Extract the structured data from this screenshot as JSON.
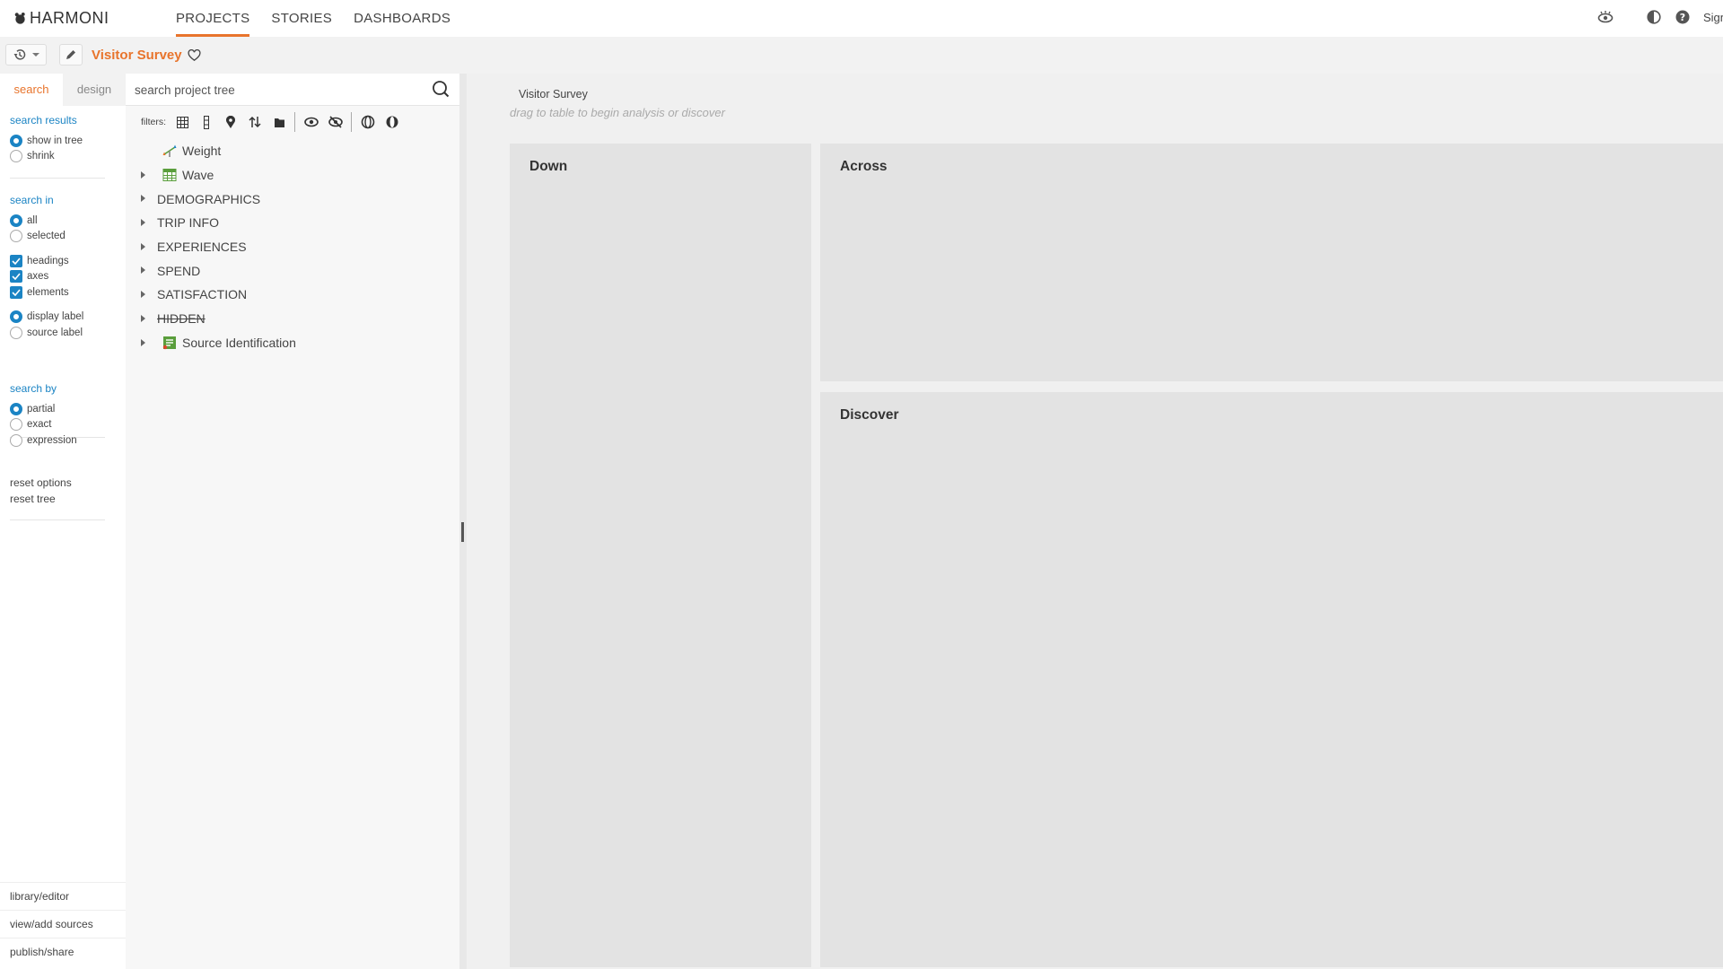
{
  "app": {
    "logo_text": "HARMONI",
    "nav": [
      {
        "label": "PROJECTS",
        "active": true
      },
      {
        "label": "STORIES",
        "active": false
      },
      {
        "label": "DASHBOARDS",
        "active": false
      }
    ],
    "sign_text": "Sign",
    "accent_color": "#e8742c",
    "link_color": "#1b84c4",
    "icons": [
      "view-icon",
      "contrast-icon",
      "help-icon"
    ]
  },
  "toolbar": {
    "history_icon": "history-icon",
    "edit_icon": "pencil-icon",
    "project_name": "Visitor Survey",
    "favorite_icon": "heart-icon"
  },
  "left_panel": {
    "tabs": [
      {
        "label": "search",
        "active": true
      },
      {
        "label": "design",
        "active": false
      }
    ],
    "search_results": {
      "heading": "search results",
      "options": [
        {
          "label": "show in tree",
          "selected": true
        },
        {
          "label": "shrink",
          "selected": false
        }
      ]
    },
    "search_in": {
      "heading": "search in",
      "scope": [
        {
          "label": "all",
          "selected": true
        },
        {
          "label": "selected",
          "selected": false
        }
      ],
      "types": [
        {
          "label": "headings",
          "checked": true
        },
        {
          "label": "axes",
          "checked": true
        },
        {
          "label": "elements",
          "checked": true
        }
      ],
      "label_kind": [
        {
          "label": "display label",
          "selected": true
        },
        {
          "label": "source label",
          "selected": false
        }
      ]
    },
    "search_by": {
      "heading": "search by",
      "options": [
        {
          "label": "partial",
          "selected": true
        },
        {
          "label": "exact",
          "selected": false
        },
        {
          "label": "expression",
          "selected": false
        }
      ]
    },
    "reset_links": [
      "reset options",
      "reset tree"
    ],
    "bottom_links": [
      "library/editor",
      "view/add sources",
      "publish/share"
    ]
  },
  "tree_panel": {
    "search_placeholder": "search project tree",
    "filters_label": "filters:",
    "filter_icons": [
      "grid-icon",
      "column-icon",
      "pin-icon",
      "sort-icon",
      "folder-icon",
      "eye-icon",
      "eye-slash-icon",
      "half-circle-icon",
      "half-circle-filled-icon"
    ],
    "nodes": [
      {
        "label": "Weight",
        "icon": "weight-icon",
        "expandable": false
      },
      {
        "label": "Wave",
        "icon": "table-icon",
        "expandable": true
      },
      {
        "label": "DEMOGRAPHICS",
        "icon": "",
        "expandable": true
      },
      {
        "label": "TRIP INFO",
        "icon": "",
        "expandable": true
      },
      {
        "label": "EXPERIENCES",
        "icon": "",
        "expandable": true
      },
      {
        "label": "SPEND",
        "icon": "",
        "expandable": true
      },
      {
        "label": "SATISFACTION",
        "icon": "",
        "expandable": true
      },
      {
        "label": "HIDDEN",
        "icon": "",
        "expandable": true,
        "strikethrough": true
      },
      {
        "label": "Source Identification",
        "icon": "source-icon",
        "expandable": true
      }
    ]
  },
  "workspace": {
    "title": "Visitor Survey",
    "hint": "drag to table to begin analysis or discover",
    "zones": {
      "down": "Down",
      "across": "Across",
      "discover": "Discover"
    }
  }
}
